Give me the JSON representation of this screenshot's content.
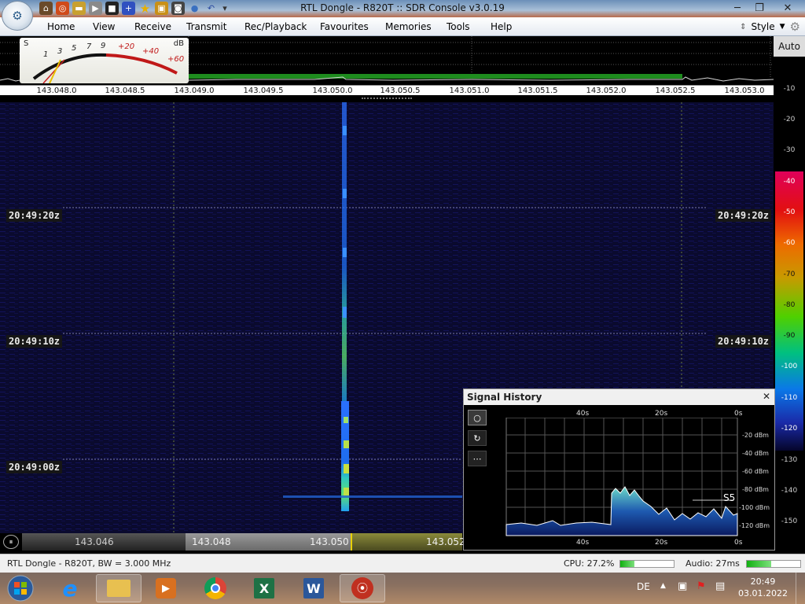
{
  "window": {
    "title": "RTL Dongle - R820T :: SDR Console v3.0.19"
  },
  "ribbon": {
    "tabs": [
      "Home",
      "View",
      "Receive",
      "Transmit",
      "Rec/Playback",
      "Favourites",
      "Memories",
      "Tools",
      "Help"
    ],
    "style_label": "Style"
  },
  "meter": {
    "s_label": "S",
    "db_label": "dB",
    "scale_black": [
      "1",
      "3",
      "5",
      "7",
      "9"
    ],
    "scale_red": [
      "+20",
      "+40",
      "+60"
    ]
  },
  "frequency_axis": [
    "143.048.0",
    "143.048.5",
    "143.049.0",
    "143.049.5",
    "143.050.0",
    "143.050.5",
    "143.051.0",
    "143.051.5",
    "143.052.0",
    "143.052.5",
    "143.053.0"
  ],
  "waterfall": {
    "timestamps": [
      "20:49:20z",
      "20:49:10z",
      "20:49:00z"
    ]
  },
  "level_scale": {
    "auto_label": "Auto",
    "labels": [
      "-10",
      "-20",
      "-30",
      "-40",
      "-50",
      "-60",
      "-70",
      "-80",
      "-90",
      "-100",
      "-110",
      "-120",
      "-130",
      "-140",
      "-150"
    ]
  },
  "bottom_axis": {
    "labels": [
      "143.046",
      "143.048",
      "143.050",
      "143.052"
    ]
  },
  "signal_history": {
    "title": "Signal History",
    "close": "✕",
    "time_labels": [
      "40s",
      "20s",
      "0s"
    ],
    "dbm_labels": [
      "-20 dBm",
      "-40 dBm",
      "-60 dBm",
      "-80 dBm",
      "-100 dBm",
      "-120 dBm"
    ],
    "s_reading": "S5",
    "buttons": [
      "○",
      "↻",
      "⋯"
    ]
  },
  "status": {
    "device": "RTL Dongle - R820T, BW = 3.000 MHz",
    "cpu_label": "CPU: 27.2%",
    "cpu_fraction": 0.272,
    "audio_label": "Audio: 27ms",
    "audio_fraction": 0.45
  },
  "taskbar": {
    "lang": "DE",
    "time": "20:49",
    "date": "03.01.2022"
  },
  "colors": {
    "signal": "#38d0ff",
    "accent": "#1e8c1e"
  }
}
